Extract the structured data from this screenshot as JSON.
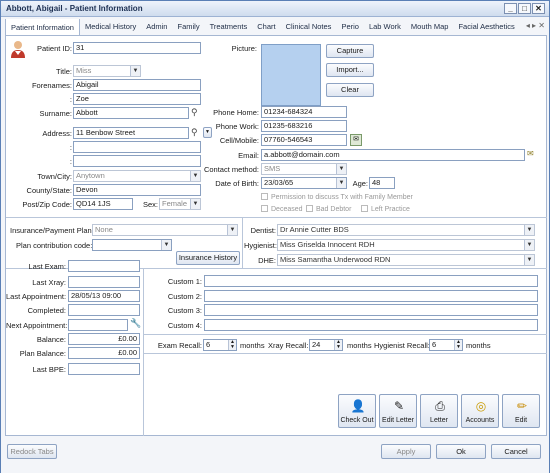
{
  "window": {
    "title": "Abbott, Abigail - Patient Information",
    "min": "_",
    "max": "□",
    "close": "✕"
  },
  "tabs": [
    "Patient Information",
    "Medical History",
    "Admin",
    "Family",
    "Treatments",
    "Chart",
    "Clinical Notes",
    "Perio",
    "Lab Work",
    "Mouth Map",
    "Facial Aesthetics"
  ],
  "tab_nav": "◂ ▸ ✕",
  "patient": {
    "patient_id_label": "Patient ID:",
    "patient_id": "31",
    "title_label": "Title:",
    "title": "Miss",
    "forenames_label": "Forenames:",
    "forename1": "Abigail",
    "forename2_label": ":",
    "forename2": "Zoe",
    "surname_label": "Surname:",
    "surname": "Abbott",
    "address_label": "Address:",
    "address1": "11 Benbow Street",
    "address2_label": ":",
    "address2": "",
    "address3_label": ":",
    "address3": "",
    "town_label": "Town/City:",
    "town": "Anytown",
    "county_label": "County/State:",
    "county": "Devon",
    "post_label": "Post/Zip Code:",
    "postcode": "QD14 1JS",
    "sex_label": "Sex:",
    "sex": "Female"
  },
  "picture": {
    "label": "Picture:",
    "capture": "Capture",
    "import": "Import...",
    "clear": "Clear"
  },
  "contact": {
    "phone_home_label": "Phone Home:",
    "phone_home": "01234-684324",
    "phone_work_label": "Phone Work:",
    "phone_work": "01235-683216",
    "cell_label": "Cell/Mobile:",
    "cell": "07760-546543",
    "email_label": "Email:",
    "email": "a.abbott@domain.com",
    "method_label": "Contact method:",
    "method": "SMS",
    "dob_label": "Date of Birth:",
    "dob": "23/03/65",
    "age_label": "Age:",
    "age": "48",
    "permission": "Permission to discuss Tx with Family Member",
    "deceased": "Deceased",
    "bad_debtor": "Bad Debtor",
    "left_practice": "Left Practice"
  },
  "insurance": {
    "plan_label": "Insurance/Payment Plan:",
    "plan": "None",
    "contrib_label": "Plan contribution code:",
    "contrib": "",
    "history_btn": "Insurance History"
  },
  "staff": {
    "dentist_label": "Dentist:",
    "dentist": "Dr Annie Cutter BDS",
    "hygienist_label": "Hygienist:",
    "hygienist": "Miss Griselda Innocent RDH",
    "dhe_label": "DHE:",
    "dhe": "Miss Samantha Underwood RDN"
  },
  "visits": {
    "last_exam_label": "Last Exam:",
    "last_exam": "",
    "last_xray_label": "Last Xray:",
    "last_xray": "",
    "last_appt_label": "Last Appointment:",
    "last_appt": "28/05/13 09:00",
    "completed_label": "Completed:",
    "completed": "",
    "next_appt_label": "Next Appointment:",
    "next_appt": "",
    "balance_label": "Balance:",
    "balance": "£0.00",
    "plan_balance_label": "Plan Balance:",
    "plan_balance": "£0.00",
    "last_bpe_label": "Last BPE:",
    "last_bpe": ""
  },
  "custom": [
    {
      "label": "Custom 1:",
      "value": ""
    },
    {
      "label": "Custom 2:",
      "value": ""
    },
    {
      "label": "Custom 3:",
      "value": ""
    },
    {
      "label": "Custom 4:",
      "value": ""
    }
  ],
  "recall": {
    "exam_label": "Exam Recall:",
    "exam": "6",
    "xray_label": "Xray Recall:",
    "xray": "24",
    "hyg_label": "Hygienist Recall:",
    "hyg": "6",
    "unit": "months"
  },
  "actions": [
    "Check Out",
    "Edit Letter",
    "Letter",
    "Accounts",
    "Edit"
  ],
  "footer": {
    "redock": "Redock Tabs",
    "apply": "Apply",
    "ok": "Ok",
    "cancel": "Cancel"
  }
}
